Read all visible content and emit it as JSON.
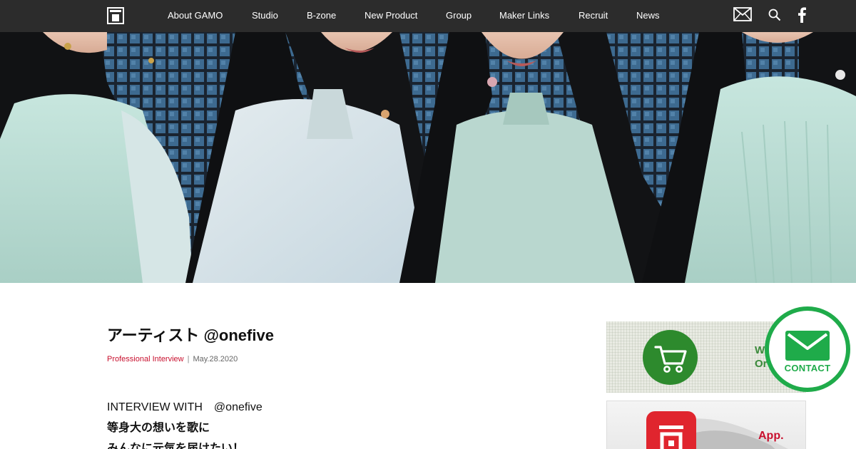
{
  "nav": {
    "logo_icon": "gamo-square-logo",
    "items": [
      "About GAMO",
      "Studio",
      "B-zone",
      "New Product",
      "Group",
      "Maker Links",
      "Recruit",
      "News"
    ],
    "icons": [
      "mail-icon",
      "search-icon",
      "facebook-icon"
    ],
    "background": "#2c2c2c"
  },
  "hero": {
    "description_icon": "hero-photo"
  },
  "article": {
    "title": "アーティスト @onefive",
    "category": "Professional Interview",
    "separator": "|",
    "date": "May.28.2020",
    "intro": "INTERVIEW WITH　@onefive",
    "catch_lines": [
      "等身大の想いを歌に",
      "みんなに元気を届けたい！"
    ]
  },
  "sidebar": {
    "shop_banner": {
      "icon": "cart-icon",
      "text_lines": [
        "W",
        "Or"
      ],
      "color": "#2d8a2d"
    },
    "app_banner": {
      "icon": "app-icon",
      "text": "App.",
      "color": "#c8102e"
    }
  },
  "contact": {
    "label": "CONTACT",
    "icon": "envelope-icon",
    "color": "#1fab4a"
  }
}
